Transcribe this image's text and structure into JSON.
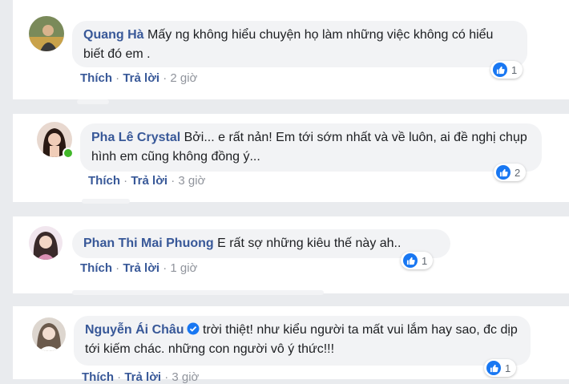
{
  "comments": [
    {
      "author": "Quang Hà",
      "text": "Mấy ng không hiểu chuyện họ làm những việc không có hiểu biết đó em .",
      "like_label": "Thích",
      "reply_label": "Trả lời",
      "time": "2 giờ",
      "reactions": "1"
    },
    {
      "author": "Pha Lê Crystal",
      "text": "Bởi... e rất nản! Em tới sớm nhất và về luôn, ai đề nghị chụp hình em cũng không đồng ý...",
      "like_label": "Thích",
      "reply_label": "Trả lời",
      "time": "3 giờ",
      "reactions": "2"
    },
    {
      "author": "Phan Thi Mai Phuong",
      "text": "E rất sợ những kiêu thế này ah..",
      "like_label": "Thích",
      "reply_label": "Trả lời",
      "time": "1 giờ",
      "reactions": "1"
    },
    {
      "author": "Nguyễn Ái Châu",
      "text": "trời thiệt! như kiểu người ta mất vui lắm hay sao, đc dịp tới kiếm chác. những con người vô ý thức!!!",
      "like_label": "Thích",
      "reply_label": "Trả lời",
      "time": "3 giờ",
      "reactions": "1",
      "verified": true
    }
  ],
  "separator": "·",
  "colors": {
    "link": "#385898",
    "like_blue": "#1877f2",
    "bubble": "#f2f3f5",
    "online": "#42b72a"
  }
}
